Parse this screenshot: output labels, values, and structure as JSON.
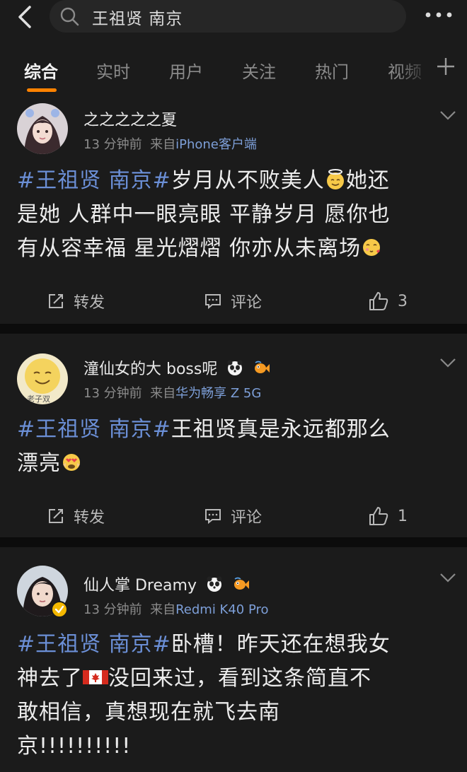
{
  "search": {
    "query": "王祖贤 南京"
  },
  "tabs": [
    {
      "label": "综合"
    },
    {
      "label": "实时"
    },
    {
      "label": "用户"
    },
    {
      "label": "关注"
    },
    {
      "label": "热门"
    },
    {
      "label": "视频"
    }
  ],
  "posts": [
    {
      "username": "之之之之之夏",
      "time": "13 分钟前",
      "source_prefix": "来自",
      "source": "iPhone客户端",
      "tag": "#王祖贤 南京#",
      "line1": "岁月从不败美人",
      "line1b": "她还",
      "line2": "是她 人群中一眼亮眼 平静岁月 愿你也",
      "line3": "有从容幸福 星光熠熠 你亦从未离场",
      "repost": "转发",
      "comment": "评论",
      "likes": "3"
    },
    {
      "username": "潼仙女的大 boss呢",
      "time": "13 分钟前",
      "source_prefix": "来自",
      "source": "华为畅享 Z 5G",
      "avatar_text": "老子双",
      "tag": "#王祖贤 南京#",
      "line1": "王祖贤真是永远都那么",
      "line2": "漂亮",
      "repost": "转发",
      "comment": "评论",
      "likes": "1"
    },
    {
      "username": "仙人掌 Dreamy",
      "time": "13 分钟前",
      "source_prefix": "来自",
      "source": "Redmi K40 Pro",
      "tag": "#王祖贤 南京#",
      "line1": "卧槽！昨天还在想我女",
      "line2a": "神去了",
      "line2b": "没回来过，看到这条简直不",
      "line3": "敢相信，真想现在就飞去南",
      "line4": "京!!!!!!!!!!"
    }
  ],
  "colors": {
    "accent": "#ff8200",
    "link": "#6b8fd6",
    "source": "#7d9fd8"
  }
}
